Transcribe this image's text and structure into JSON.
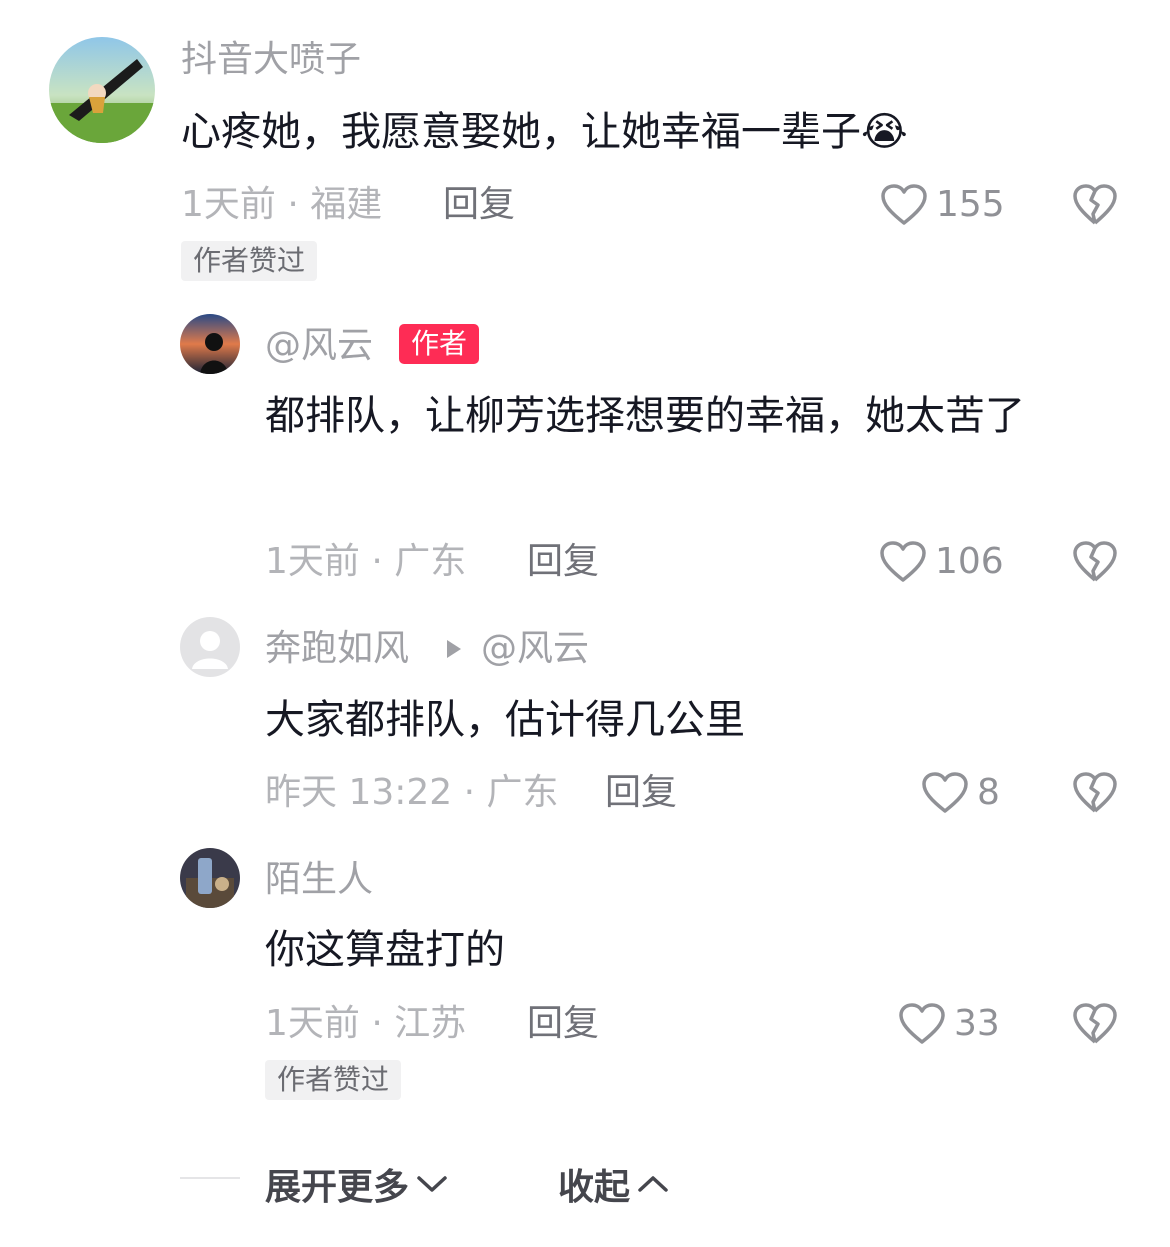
{
  "comments": [
    {
      "username": "抖音大喷子",
      "text": "心疼她，我愿意娶她，让她幸福一辈子",
      "emoji": "😭",
      "time_location": "1天前 · 福建",
      "reply_label": "回复",
      "likes": "155",
      "badge": "作者赞过"
    },
    {
      "username": "@风云",
      "author_tag": "作者",
      "text": "都排队，让柳芳选择想要的幸福，她太苦了",
      "time_location": "1天前 · 广东",
      "reply_label": "回复",
      "likes": "106"
    },
    {
      "username": "奔跑如风",
      "reply_to": "@风云",
      "text": "大家都排队，估计得几公里",
      "time_location": "昨天 13:22 · 广东",
      "reply_label": "回复",
      "likes": "8"
    },
    {
      "username": "陌生人",
      "text": "你这算盘打的",
      "time_location": "1天前 · 江苏",
      "reply_label": "回复",
      "likes": "33",
      "badge": "作者赞过"
    }
  ],
  "footer": {
    "expand_label": "展开更多",
    "collapse_label": "收起"
  },
  "colors": {
    "author_tag": "#fe2c55",
    "text": "#161823",
    "meta": "#b3b4b8"
  }
}
